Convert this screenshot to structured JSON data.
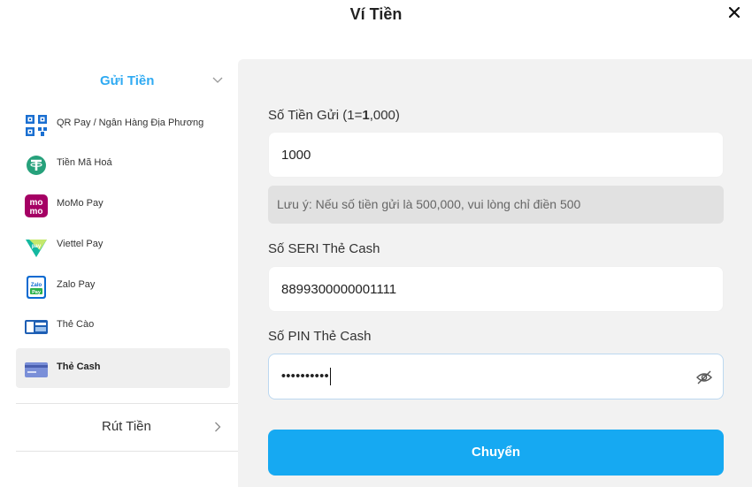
{
  "header": {
    "title": "Ví Tiền"
  },
  "sidebar": {
    "deposit_label": "Gửi Tiền",
    "methods": [
      {
        "label": "QR Pay / Ngân Hàng Địa Phương",
        "icon": "qr-code-icon"
      },
      {
        "label": "Tiền Mã Hoá",
        "icon": "tether-icon"
      },
      {
        "label": "MoMo Pay",
        "icon": "momo-icon"
      },
      {
        "label": "Viettel Pay",
        "icon": "viettel-pay-icon"
      },
      {
        "label": "Zalo Pay",
        "icon": "zalo-pay-icon"
      },
      {
        "label": "Thẻ Cào",
        "icon": "scratch-card-icon"
      },
      {
        "label": "Thẻ Cash",
        "icon": "cash-card-icon"
      }
    ],
    "active_method": "Thẻ Cash",
    "withdraw_label": "Rút Tiền"
  },
  "form": {
    "amount_label_prefix": "Số Tiền Gửi (1=",
    "amount_label_bold": "1",
    "amount_label_suffix": ",000)",
    "amount_value": "1000",
    "note": "Lưu ý: Nếu số tiền gửi là 500,000, vui lòng chỉ điền 500",
    "serial_label": "Số SERI Thẻ Cash",
    "serial_value": "8899300000001111",
    "pin_label": "Số PIN Thẻ Cash",
    "pin_value": "••••••••••",
    "submit_label": "Chuyển"
  },
  "colors": {
    "accent": "#16a9f2",
    "deposit_text": "#2faaf2",
    "panel_bg": "#f2f2f2"
  }
}
